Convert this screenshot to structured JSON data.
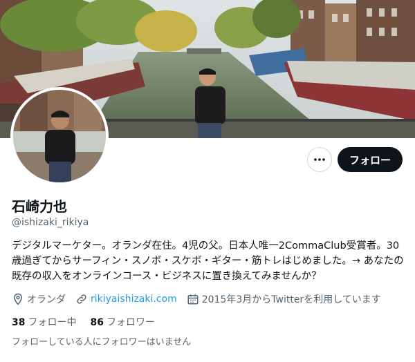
{
  "profile": {
    "display_name": "石崎力也",
    "handle": "@ishizaki_rikiya",
    "bio": "デジタルマーケター。オランダ在住。4児の父。日本人唯一2CommaClub受賞者。30歳過ぎてからサーフィン・スノボ・スケボ・ギター・筋トレはじめました。→ あなたの既存の収入をオンラインコース・ビジネスに置き換えてみませんか？",
    "location": "オランダ",
    "website": "rikiyaishizaki.com",
    "joined": "2015年3月からTwitterを利用しています"
  },
  "actions": {
    "follow_label": "フォロー",
    "more_icon": "more-horizontal-icon"
  },
  "stats": {
    "following_count": "38",
    "following_label": "フォロー中",
    "followers_count": "86",
    "followers_label": "フォロワー"
  },
  "followers_you_know": "フォローしている人にフォロワーはいません",
  "colors": {
    "accent": "#1d9bf0",
    "text": "#0f1419",
    "muted": "#536471",
    "button_bg": "#0f1419"
  }
}
